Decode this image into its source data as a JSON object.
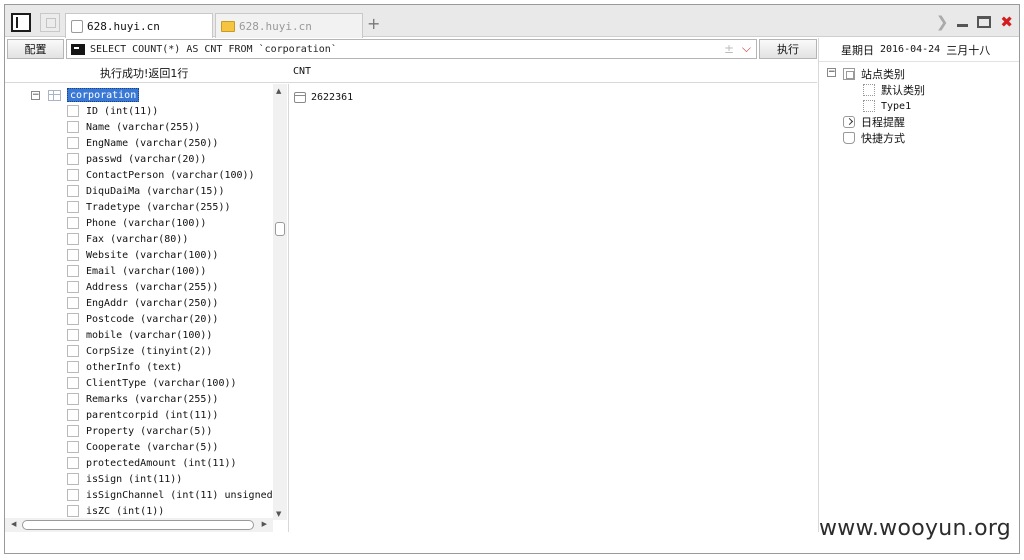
{
  "tabs": [
    {
      "label": "628.huyi.cn",
      "active": true
    },
    {
      "label": "628.huyi.cn",
      "active": false
    }
  ],
  "new_tab_label": "+",
  "toolbar": {
    "config_label": "配置",
    "query": "SELECT COUNT(*) AS CNT FROM `corporation`",
    "query_pm": "±",
    "execute_label": "执行"
  },
  "status": {
    "message": "执行成功!返回1行",
    "column_header": "CNT"
  },
  "tree": {
    "table_name": "corporation",
    "fields": [
      "ID (int(11))",
      "Name (varchar(255))",
      "EngName (varchar(250))",
      "passwd (varchar(20))",
      "ContactPerson (varchar(100))",
      "DiquDaiMa (varchar(15))",
      "Tradetype (varchar(255))",
      "Phone (varchar(100))",
      "Fax (varchar(80))",
      "Website (varchar(100))",
      "Email (varchar(100))",
      "Address (varchar(255))",
      "EngAddr (varchar(250))",
      "Postcode (varchar(20))",
      "mobile (varchar(100))",
      "CorpSize (tinyint(2))",
      "otherInfo (text)",
      "ClientType (varchar(100))",
      "Remarks (varchar(255))",
      "parentcorpid (int(11))",
      "Property (varchar(5))",
      "Cooperate (varchar(5))",
      "protectedAmount (int(11))",
      "isSign (int(11))",
      "isSignChannel (int(11) unsigned",
      "isZC (int(1))"
    ]
  },
  "result": {
    "value": "2622361"
  },
  "sidebar": {
    "weekday": "星期日",
    "date": "2016-04-24",
    "lunar_date": "三月十八",
    "sites_label": "站点类别",
    "default_category": "默认类别",
    "type1": "Type1",
    "schedule_label": "日程提醒",
    "shortcuts_label": "快捷方式"
  },
  "watermark": "www.wooyun.org"
}
